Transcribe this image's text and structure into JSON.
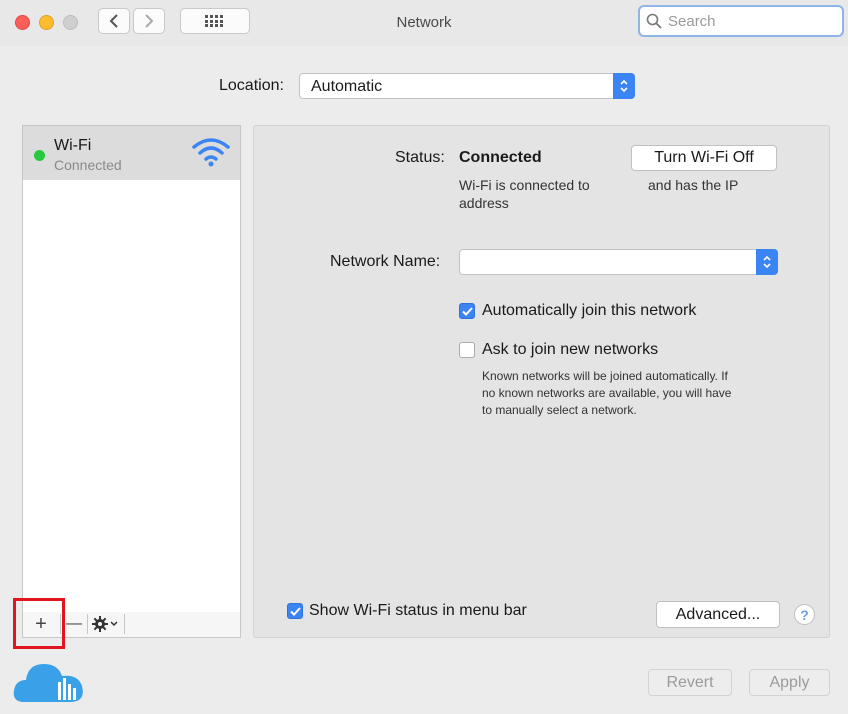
{
  "window": {
    "title": "Network"
  },
  "titlebar": {
    "back_icon": "chevron-left-icon",
    "forward_icon": "chevron-right-icon",
    "grid_icon": "grid-icon"
  },
  "search": {
    "placeholder": "Search",
    "icon": "search-icon"
  },
  "location": {
    "label": "Location:",
    "value": "Automatic"
  },
  "sidebar": {
    "items": [
      {
        "name": "Wi-Fi",
        "status": "Connected",
        "status_color": "#28c940",
        "icon": "wifi-icon"
      }
    ],
    "tools": {
      "add": "+",
      "remove": "—",
      "action_icon": "gear-icon"
    }
  },
  "main": {
    "status_label": "Status:",
    "status_value": "Connected",
    "status_desc_line1": "Wi-Fi is connected to",
    "status_desc_line2": "address",
    "status_desc_right": "and has the IP",
    "turn_off_button": "Turn Wi-Fi Off",
    "network_name_label": "Network Name:",
    "network_name_value": "",
    "auto_join": {
      "label": "Automatically join this network",
      "checked": true
    },
    "ask_join": {
      "label": "Ask to join new networks",
      "checked": false
    },
    "help_text_line1": "Known networks will be joined automatically. If",
    "help_text_line2": "no known networks are available, you will have",
    "help_text_line3": "to manually select a network.",
    "show_status": {
      "label": "Show Wi-Fi status in menu bar",
      "checked": true
    },
    "advanced_button": "Advanced...",
    "help_button": "?"
  },
  "footer": {
    "revert_button": "Revert",
    "apply_button": "Apply"
  },
  "colors": {
    "accent": "#3b84f3",
    "highlight": "#e0151d",
    "watermark": "#3aa0e8"
  }
}
